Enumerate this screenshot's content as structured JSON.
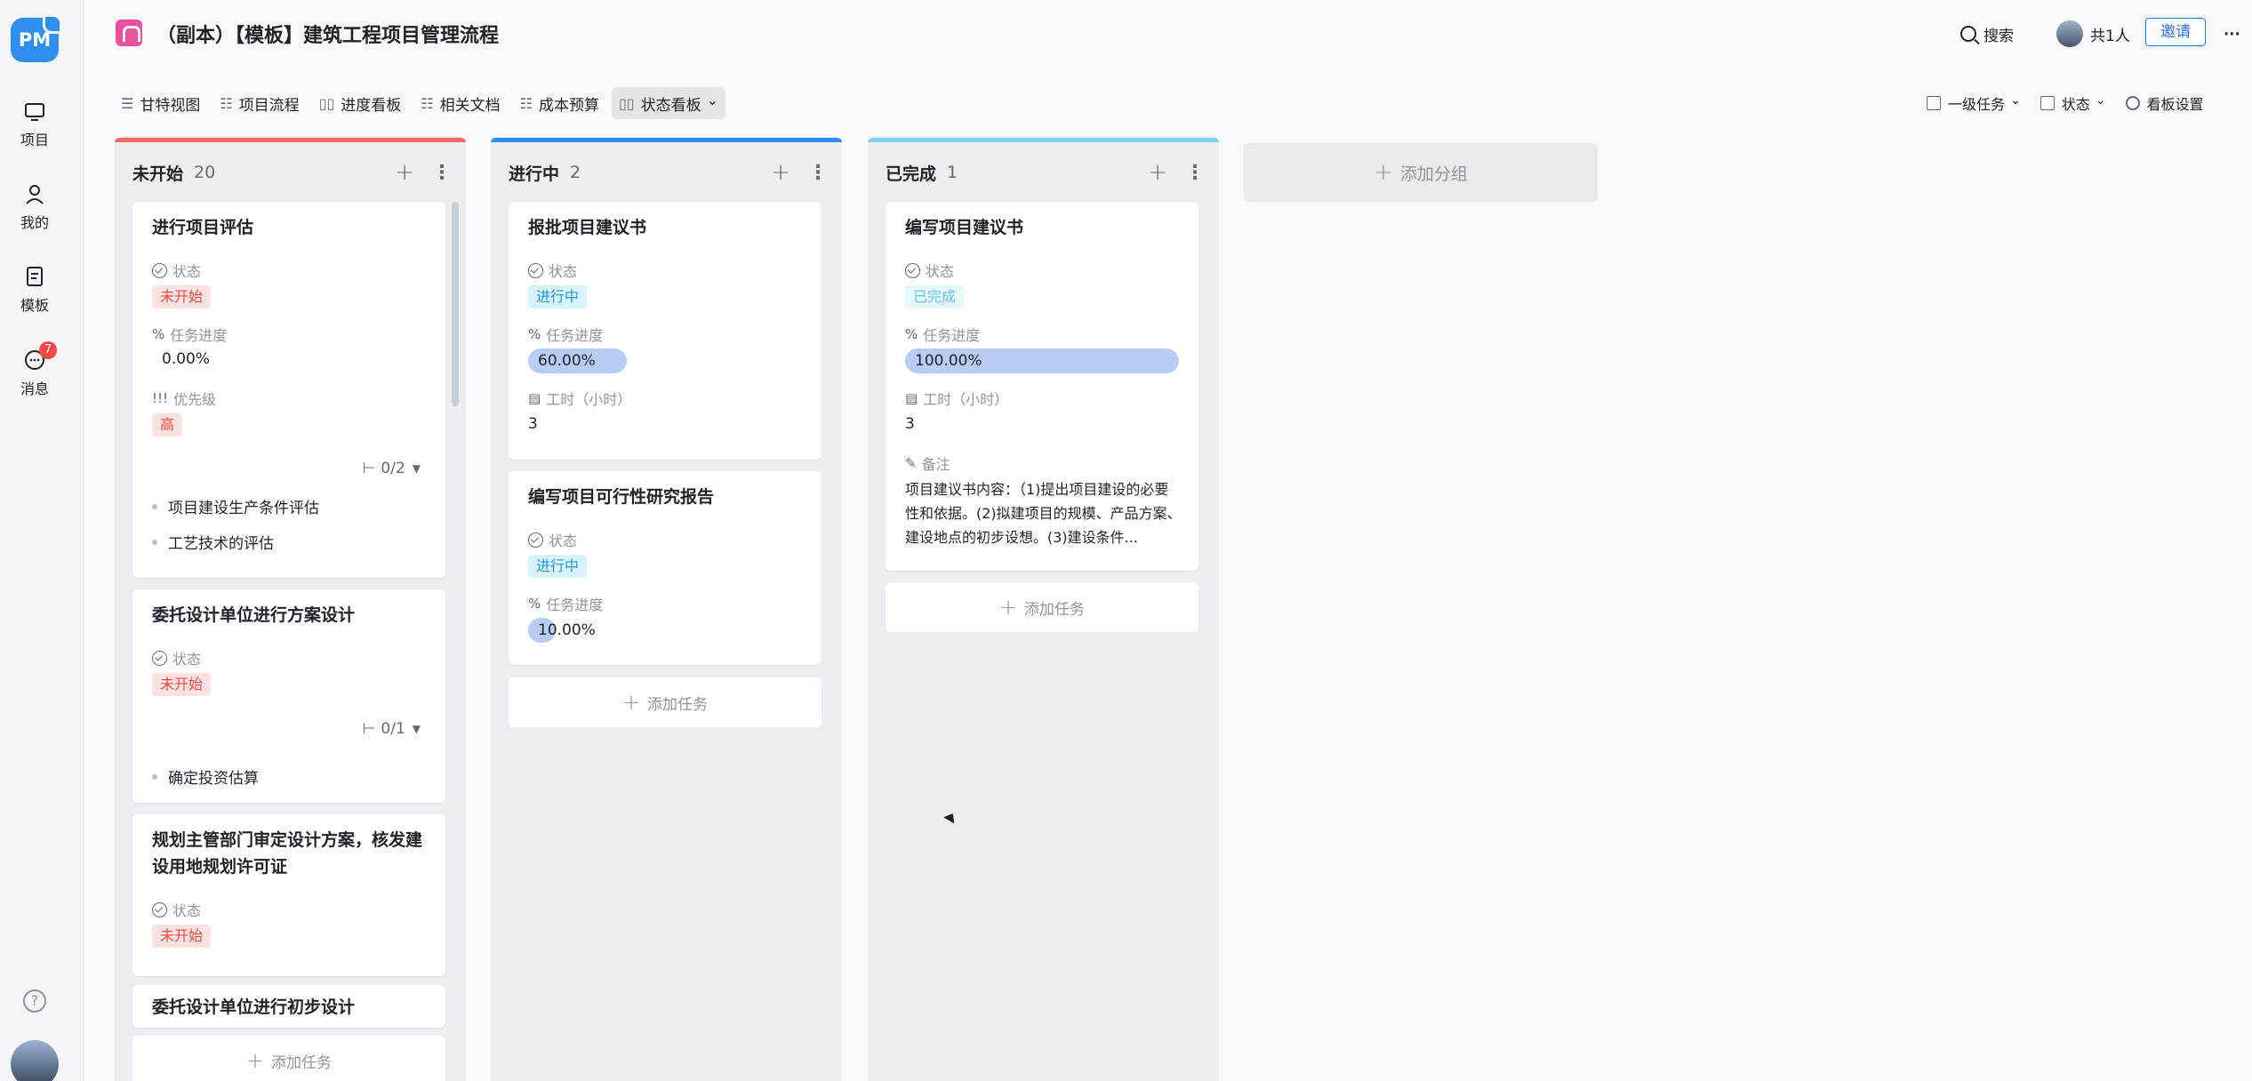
{
  "app": {
    "logo": "PM"
  },
  "rail": {
    "items": [
      {
        "label": "项目",
        "icon": "monitor-icon"
      },
      {
        "label": "我的",
        "icon": "person-icon"
      },
      {
        "label": "模板",
        "icon": "template-icon"
      },
      {
        "label": "消息",
        "icon": "message-icon",
        "badge": "7"
      }
    ]
  },
  "header": {
    "title": "（副本）【模板】建筑工程项目管理流程",
    "search_label": "搜索",
    "members_label": "共1人",
    "invite_label": "邀请",
    "more": "···"
  },
  "tabs": [
    {
      "label": "甘特视图",
      "icon": "gantt-icon"
    },
    {
      "label": "项目流程",
      "icon": "list-icon"
    },
    {
      "label": "进度看板",
      "icon": "board-icon"
    },
    {
      "label": "相关文档",
      "icon": "list-icon"
    },
    {
      "label": "成本预算",
      "icon": "list-icon"
    },
    {
      "label": "状态看板",
      "icon": "board-icon",
      "active": true
    }
  ],
  "view_controls": {
    "group_by": "一级任务",
    "field": "状态",
    "settings": "看板设置"
  },
  "columns": [
    {
      "name": "未开始",
      "count": "20",
      "color": "#f76964",
      "cards": [
        {
          "title": "进行项目评估",
          "status_label": "状态",
          "status": "未开始",
          "progress_label": "任务进度",
          "progress": "0.00%",
          "priority_label": "优先级",
          "priority": "高",
          "subtasks": "0/2",
          "subitems": [
            "项目建设生产条件评估",
            "工艺技术的评估"
          ]
        },
        {
          "title": "委托设计单位进行方案设计",
          "status_label": "状态",
          "status": "未开始",
          "subtasks": "0/1",
          "subitems": [
            "确定投资估算"
          ]
        },
        {
          "title": "规划主管部门审定设计方案，核发建设用地规划许可证",
          "status_label": "状态",
          "status": "未开始"
        },
        {
          "title": "委托设计单位进行初步设计"
        }
      ],
      "add_task": "添加任务"
    },
    {
      "name": "进行中",
      "count": "2",
      "color": "#2f8ef0",
      "cards": [
        {
          "title": "报批项目建议书",
          "status_label": "状态",
          "status": "进行中",
          "progress_label": "任务进度",
          "progress": "60.00%",
          "progress_value": 0.6,
          "hours_label": "工时（小时）",
          "hours": "3"
        },
        {
          "title": "编写项目可行性研究报告",
          "status_label": "状态",
          "status": "进行中",
          "progress_label": "任务进度",
          "progress": "10.00%",
          "progress_value": 0.1
        }
      ],
      "add_task": "添加任务"
    },
    {
      "name": "已完成",
      "count": "1",
      "color": "#7fd4f5",
      "cards": [
        {
          "title": "编写项目建议书",
          "status_label": "状态",
          "status": "已完成",
          "progress_label": "任务进度",
          "progress": "100.00%",
          "progress_value": 1.0,
          "hours_label": "工时（小时）",
          "hours": "3",
          "note_label": "备注",
          "note": "项目建议书内容：（1)提出项目建设的必要性和依据。(2)拟建项目的规模、产品方案、建设地点的初步设想。(3)建设条件..."
        }
      ],
      "add_task": "添加任务"
    }
  ],
  "add_group": "添加分组"
}
